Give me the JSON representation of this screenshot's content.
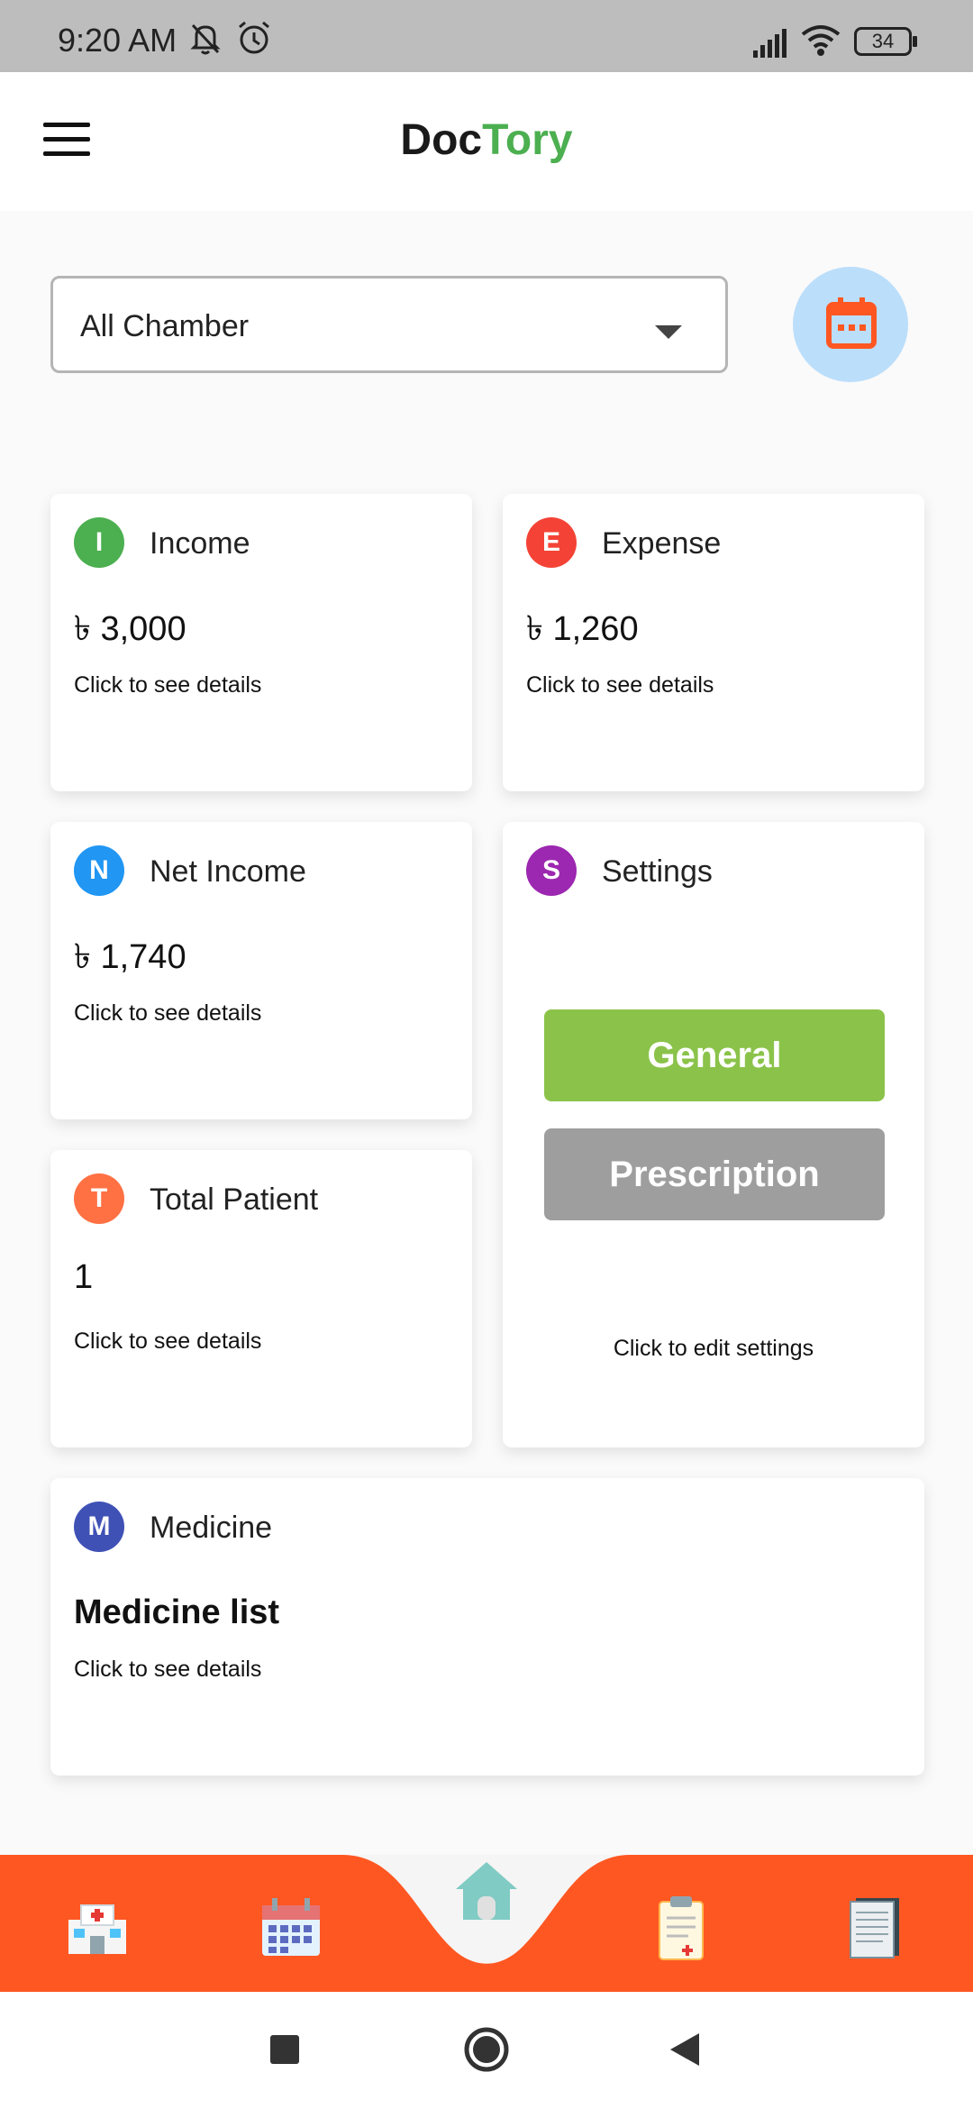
{
  "status_bar": {
    "time": "9:20 AM",
    "battery": "34"
  },
  "header": {
    "title_part1": "Doc",
    "title_part2": "Tory",
    "title_color2": "#4caf50"
  },
  "filter": {
    "selected": "All Chamber"
  },
  "cards": {
    "income": {
      "initial": "I",
      "title": "Income",
      "value": "৳ 3,000",
      "hint": "Click to see details",
      "color": "#4caf50"
    },
    "expense": {
      "initial": "E",
      "title": "Expense",
      "value": "৳ 1,260",
      "hint": "Click to see details",
      "color": "#f44336"
    },
    "net_income": {
      "initial": "N",
      "title": "Net Income",
      "value": "৳ 1,740",
      "hint": "Click to see details",
      "color": "#2196f3"
    },
    "settings": {
      "initial": "S",
      "title": "Settings",
      "general_label": "General",
      "prescription_label": "Prescription",
      "hint": "Click to edit settings",
      "color": "#9c27b0"
    },
    "total_patient": {
      "initial": "T",
      "title": "Total Patient",
      "value": "1",
      "hint": "Click to see details",
      "color": "#ff7043"
    },
    "medicine": {
      "initial": "M",
      "title": "Medicine",
      "value": "Medicine list",
      "hint": "Click to see details",
      "color": "#3f51b5"
    }
  },
  "bottom_nav": {
    "accent": "#ff5722",
    "items": [
      "hospital-icon",
      "calendar-icon",
      "home-icon",
      "clipboard-icon",
      "notes-icon"
    ]
  },
  "system_nav": [
    "recents-button",
    "home-button",
    "back-button"
  ]
}
